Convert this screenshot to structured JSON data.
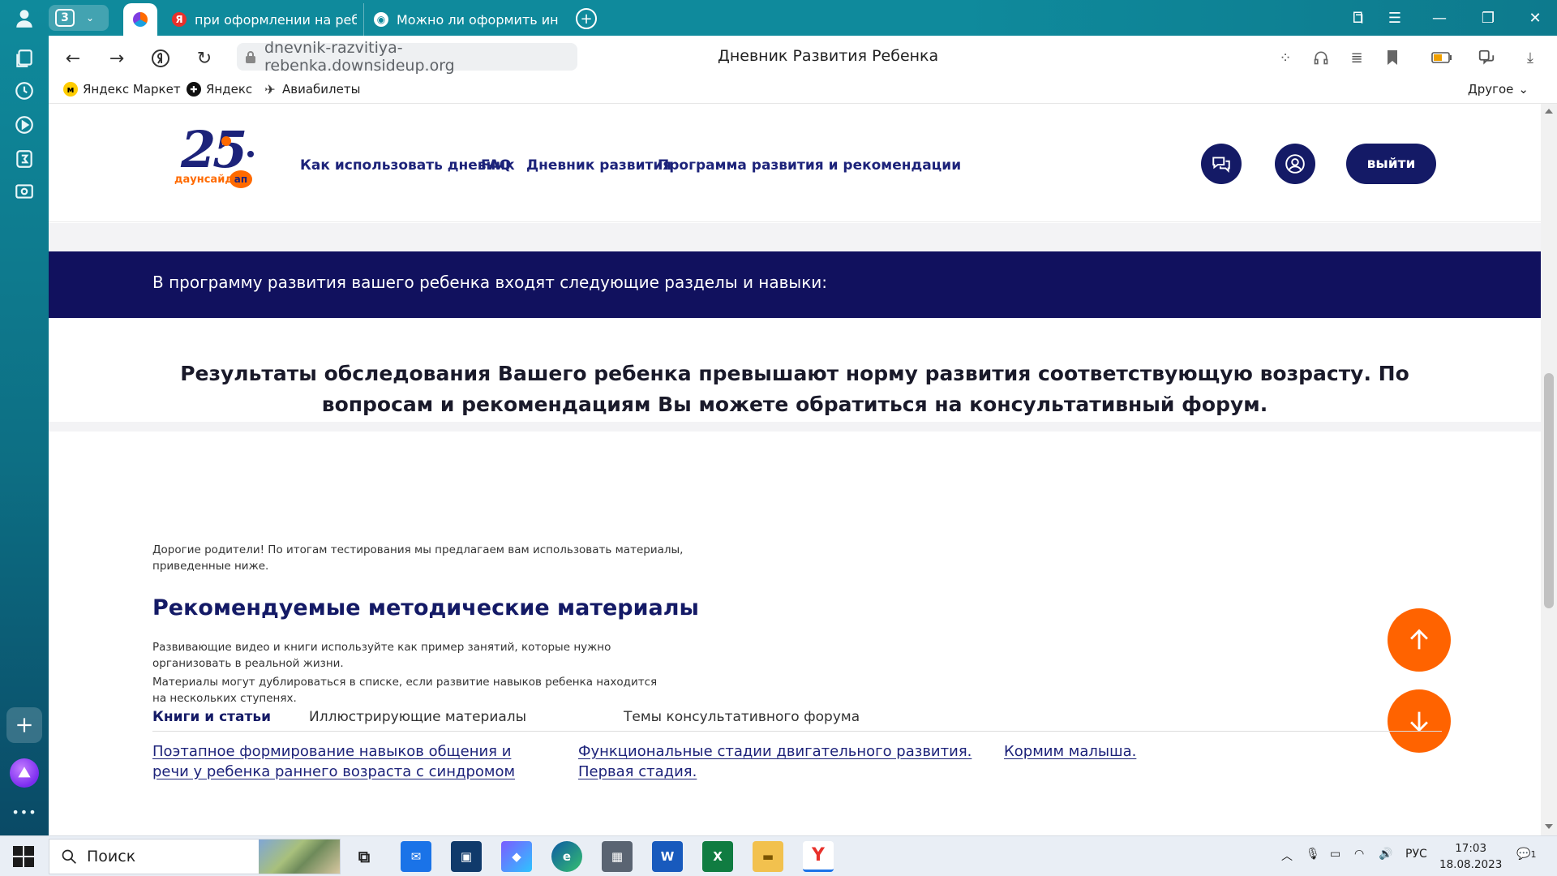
{
  "browser": {
    "tab_counter": "3",
    "tabs": [
      {
        "title": "при оформлении на ребё"
      },
      {
        "title": "Можно ли оформить инв"
      }
    ],
    "url": "dnevnik-razvitiya-rebenka.downsideup.org",
    "page_title": "Дневник Развития Ребенка",
    "bookmarks": [
      "Яндекс Маркет",
      "Яндекс",
      "Авиабилеты"
    ],
    "bookmarks_other": "Другое"
  },
  "site": {
    "logo_text": "даунсайд",
    "logo_badge": "ап",
    "logo_number": "25",
    "nav": [
      "Как использовать дневник",
      "FAQ",
      "Дневник развития",
      "Программа развития и рекомендации"
    ],
    "logout_label": "выйти",
    "banner": "В программу развития вашего ребенка входят следующие разделы и навыки:",
    "result": "Результаты обследования Вашего ребенка превышают норму развития соответствующую возрасту. По вопросам и рекомендациям Вы можете обратиться на консультативный форум.",
    "intro_line1": "Дорогие родители! По итогам тестирования мы предлагаем вам использовать материалы,",
    "intro_line2": "приведенные ниже.",
    "rec_heading": "Рекомендуемые методические материалы",
    "rec_desc_line1": "Развивающие видео и книги используйте как пример занятий, которые нужно",
    "rec_desc_line2": "организовать в реальной жизни.",
    "rec_note_line1": "Материалы могут дублироваться в списке, если развитие навыков ребенка находится",
    "rec_note_line2": "на нескольких ступенях.",
    "content_tabs": [
      "Книги и статьи",
      "Иллюстрирующие материалы",
      "Темы консультативного форума"
    ],
    "links": {
      "link1_line1": "Поэтапное формирование навыков общения и",
      "link1_line2": "речи у ребенка раннего возраста с синдромом",
      "link2_line1": "Функциональные стадии двигательного развития.",
      "link2_line2": "Первая стадия.",
      "link3": "Кормим малыша."
    }
  },
  "taskbar": {
    "search_label": "Поиск",
    "language": "РУС",
    "time": "17:03",
    "date": "18.08.2023",
    "notification_count": "1"
  },
  "colors": {
    "navy": "#141a66",
    "banner": "#11115e",
    "accent_orange": "#ff6300",
    "browser_teal": "#0f8a9c"
  }
}
